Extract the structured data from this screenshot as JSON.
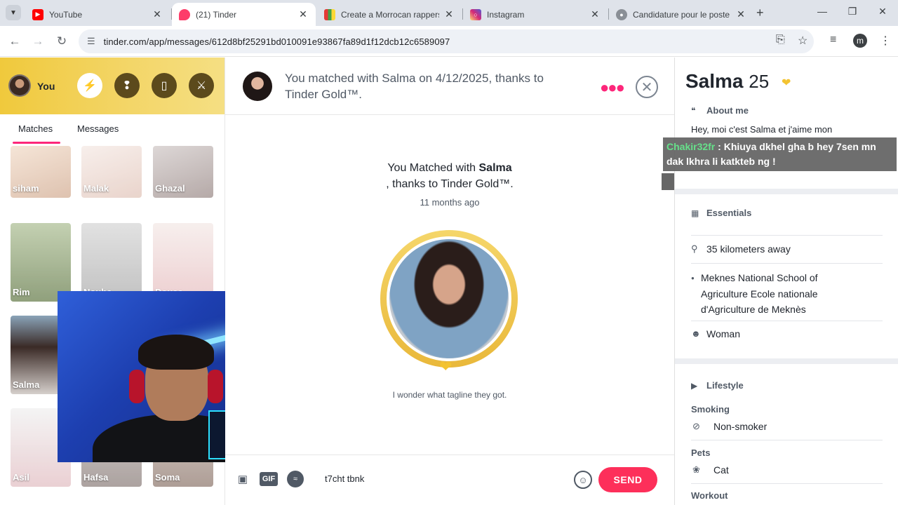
{
  "browser": {
    "tabs": [
      {
        "title": "YouTube",
        "icon": "youtube-icon",
        "color": "#ff0000"
      },
      {
        "title": "(21) Tinder",
        "icon": "tinder-icon",
        "color": "#fd3d6a"
      },
      {
        "title": "Create a Morrocan rappers T",
        "icon": "grid-app-icon",
        "color": "#1f1f1f"
      },
      {
        "title": "Instagram",
        "icon": "instagram-icon",
        "color": "#d6249f"
      },
      {
        "title": "Candidature pour le poste",
        "icon": "globe-icon",
        "color": "#5f6368"
      }
    ],
    "url": "tinder.com/app/messages/612d8bf25291bd010091e93867fa89d1f12dcb12c6589097",
    "profile_initial": "m"
  },
  "sidebar": {
    "you_label": "You",
    "tabs": {
      "matches": "Matches",
      "messages": "Messages"
    },
    "matches": [
      "siham",
      "Malak",
      "Ghazal",
      "Rim",
      "Nouha",
      "Douae",
      "Salma",
      "Asil",
      "Hafsa",
      "Soma"
    ]
  },
  "chat": {
    "header_text": "You matched with Salma on 4/12/2025, thanks to Tinder Gold™.",
    "matched_prefix": "You Matched with ",
    "matched_name": "Salma",
    "matched_suffix": ", thanks to Tinder Gold™.",
    "time_ago": "11 months ago",
    "tagline": "I wonder what tagline they got.",
    "input_value": "t7cht tbnk",
    "gif_label": "GIF",
    "send_label": "SEND"
  },
  "profile": {
    "name": "Salma",
    "age": "25",
    "about_title": "About me",
    "about_text": "Hey, moi c'est Salma et j'aime mon",
    "essentials_title": "Essentials",
    "distance": "35 kilometers away",
    "school": "Meknes National School of Agriculture Ecole nationale d'Agriculture de Meknès",
    "gender": "Woman",
    "lifestyle_title": "Lifestyle",
    "smoking_label": "Smoking",
    "smoking_value": "Non-smoker",
    "pets_label": "Pets",
    "pets_value": "Cat",
    "workout_label": "Workout"
  },
  "stream_overlay": {
    "user": "Chakir32fr",
    "message": " : Khiuya dkhel gha b hey 7sen mn dak lkhra li katkteb ng !"
  },
  "colors": {
    "tinder_pink": "#fd267a",
    "send_red": "#fd2f5a",
    "gold": "#f3c331"
  }
}
